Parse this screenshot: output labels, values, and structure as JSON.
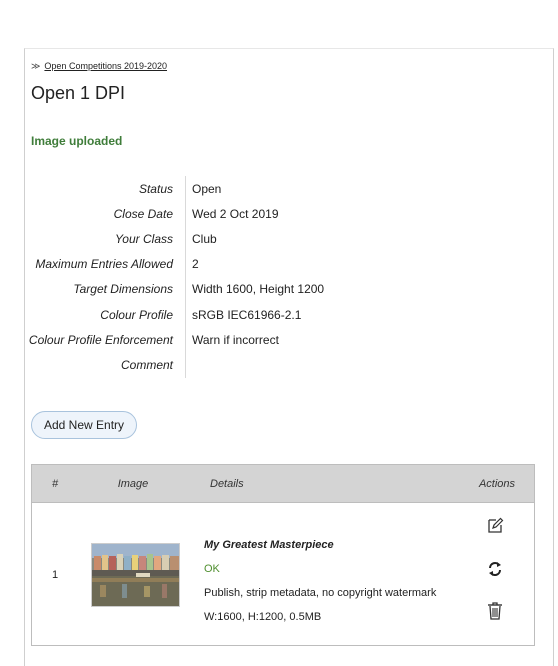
{
  "breadcrumb": {
    "arrow": "≫",
    "link": "Open Competitions 2019-2020"
  },
  "page": {
    "title": "Open 1 DPI",
    "message": "Image uploaded"
  },
  "info": [
    {
      "label": "Status",
      "value": "Open"
    },
    {
      "label": "Close Date",
      "value": "Wed 2 Oct 2019"
    },
    {
      "label": "Your Class",
      "value": "Club"
    },
    {
      "label": "Maximum Entries Allowed",
      "value": "2"
    },
    {
      "label": "Target Dimensions",
      "value": "Width 1600, Height 1200"
    },
    {
      "label": "Colour Profile",
      "value": "sRGB IEC61966-2.1"
    },
    {
      "label": "Colour Profile Enforcement",
      "value": "Warn if incorrect"
    },
    {
      "label": "Comment",
      "value": ""
    }
  ],
  "add_button": "Add New Entry",
  "table": {
    "headers": {
      "num": "#",
      "image": "Image",
      "details": "Details",
      "actions": "Actions"
    },
    "rows": [
      {
        "num": "1",
        "title": "My Greatest Masterpiece",
        "status": "OK",
        "options": "Publish, strip metadata, no copyright watermark",
        "meta": "W:1600, H:1200, 0.5MB"
      }
    ]
  },
  "icons": {
    "edit": "edit-icon",
    "replace": "refresh-icon",
    "delete": "trash-icon"
  },
  "colors": {
    "success": "#3f7d3a",
    "ok": "#4f8f2f",
    "header_bg": "#d4d4d4",
    "button_bg": "#eef4fb"
  }
}
